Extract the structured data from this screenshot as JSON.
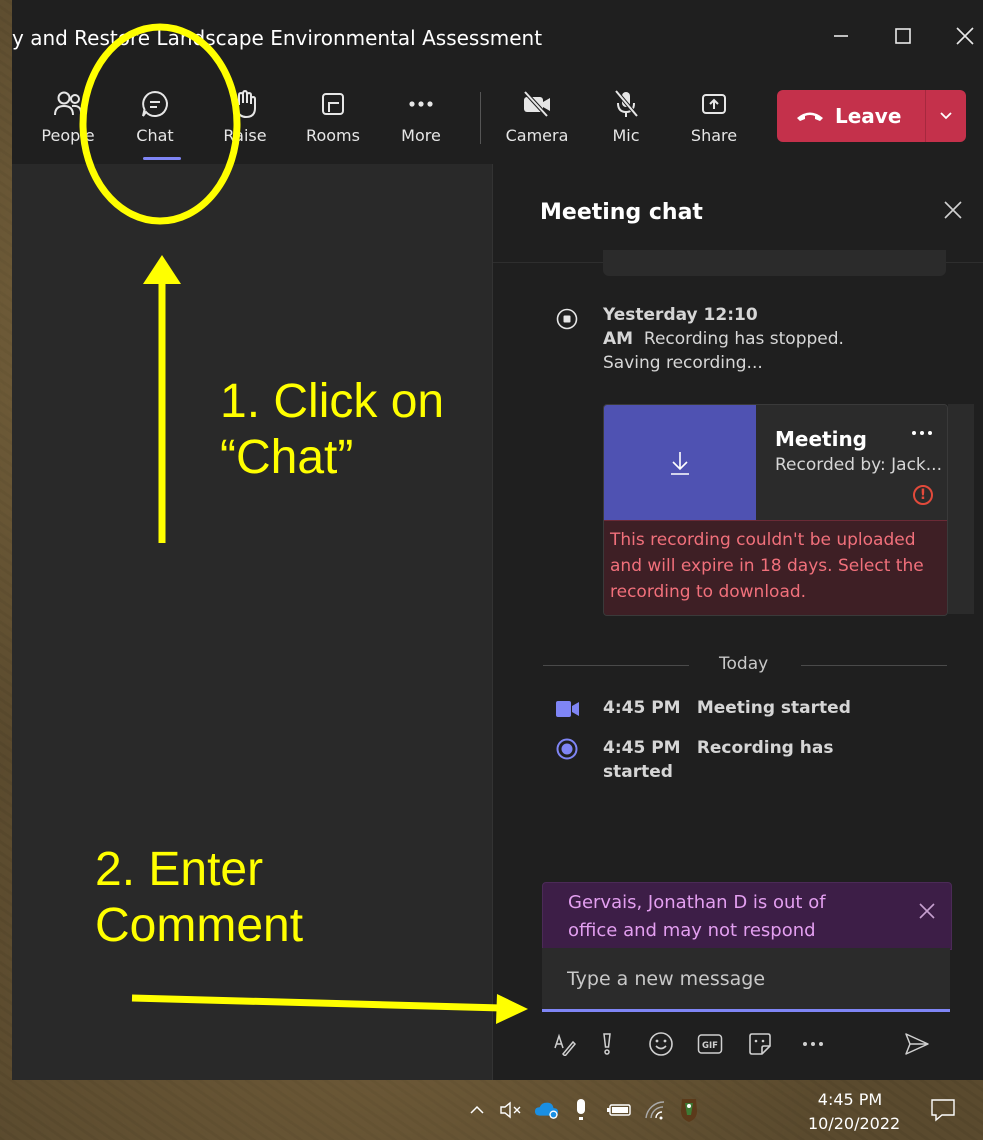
{
  "window": {
    "title": "y and Restore Landscape Environmental Assessment"
  },
  "window_controls": {
    "minimize": "—",
    "maximize": "☐",
    "close": "✕"
  },
  "toolbar": {
    "people": "People",
    "chat": "Chat",
    "raise": "Raise",
    "rooms": "Rooms",
    "more": "More",
    "camera": "Camera",
    "mic": "Mic",
    "share": "Share",
    "leave": "Leave"
  },
  "chat_panel": {
    "title": "Meeting chat",
    "events": [
      {
        "time": "Yesterday 12:10 AM",
        "text": "Recording has stopped. Saving recording..."
      }
    ],
    "recording": {
      "name": "Meeting",
      "recorded_by": "Recorded by: Jack...",
      "error": "This recording couldn't be uploaded and will expire in 18 days. Select the recording to download."
    },
    "day_divider": "Today",
    "today_events": [
      {
        "time": "4:45 PM",
        "text": "Meeting started"
      },
      {
        "time": "4:45 PM",
        "text": "Recording has started"
      }
    ],
    "out_of_office": "Gervais, Jonathan D is out of office and may not respond",
    "compose_placeholder": "Type a new message",
    "format_icons": [
      "format-icon",
      "important-icon",
      "emoji-icon",
      "gif-icon",
      "sticker-icon",
      "more-options-icon",
      "send-icon"
    ]
  },
  "annotations": {
    "step1_line1": "1. Click on",
    "step1_line2": "“Chat”",
    "step2_line1": "2. Enter",
    "step2_line2": "Comment"
  },
  "taskbar": {
    "time": "4:45 PM",
    "date": "10/20/2022"
  },
  "colors": {
    "accent": "#7f85f5",
    "leave": "#c4314b",
    "annotation": "#ffff00",
    "error_text": "#f1707b",
    "recording_thumb": "#4f52b2"
  }
}
